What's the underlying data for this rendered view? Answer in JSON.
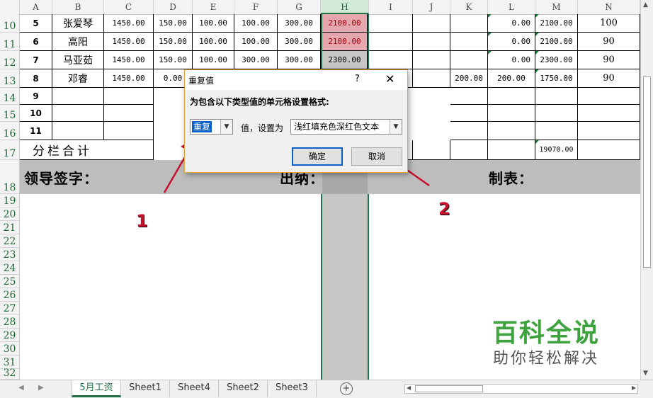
{
  "columns": [
    "A",
    "B",
    "C",
    "D",
    "E",
    "F",
    "G",
    "H",
    "I",
    "J",
    "K",
    "L",
    "M",
    "N"
  ],
  "selected_column": "H",
  "rows_visible": [
    "10",
    "11",
    "12",
    "13",
    "14",
    "15",
    "16",
    "17",
    "18",
    "19",
    "20",
    "21",
    "22",
    "23",
    "24",
    "25",
    "26",
    "27",
    "28",
    "29",
    "30",
    "31",
    "32"
  ],
  "data_rows": [
    {
      "a": "5",
      "b": "张爱琴",
      "c": "1450.00",
      "d": "150.00",
      "e": "100.00",
      "f": "100.00",
      "g": "300.00",
      "h": "2100.00",
      "l": "0.00",
      "m": "2100.00",
      "n": "100"
    },
    {
      "a": "6",
      "b": "高阳",
      "c": "1450.00",
      "d": "150.00",
      "e": "100.00",
      "f": "100.00",
      "g": "300.00",
      "h": "2100.00",
      "l": "0.00",
      "m": "2100.00",
      "n": "90"
    },
    {
      "a": "7",
      "b": "马亚茹",
      "c": "1450.00",
      "d": "150.00",
      "e": "100.00",
      "f": "300.00",
      "g": "300.00",
      "h": "2300.00",
      "l": "0.00",
      "m": "2300.00",
      "n": "90"
    },
    {
      "a": "8",
      "b": "邓睿",
      "c": "1450.00",
      "d": "0.00",
      "k": "200.00",
      "l": "200.00",
      "m": "1750.00",
      "n": "90"
    }
  ],
  "empty_rows_a": [
    "9",
    "10",
    "11"
  ],
  "subtotal_label": "分栏合计",
  "subtotal_value": "19070.00",
  "signature": {
    "leader": "领导签字：",
    "cashier": "出纳：",
    "preparer": "制表："
  },
  "dialog": {
    "title": "重复值",
    "help": "?",
    "close": "✕",
    "prompt": "为包含以下类型值的单元格设置格式:",
    "type_value": "重复",
    "middle_label": "值，设置为",
    "format_value": "浅红填充色深红色文本",
    "ok_label": "确定",
    "cancel_label": "取消"
  },
  "annotations": {
    "one": "1",
    "two": "2"
  },
  "watermark": {
    "main": "百科全说",
    "sub": "助你轻松解决"
  },
  "sheet_tabs": [
    "5月工资",
    "Sheet1",
    "Sheet4",
    "Sheet2",
    "Sheet3"
  ],
  "active_tab": "5月工资",
  "colors": {
    "accent": "#217346",
    "duplicate_fill": "#e6a6ad",
    "duplicate_text": "#9c0006",
    "annotation": "#c8102e",
    "dialog_border": "#e6a23c"
  }
}
